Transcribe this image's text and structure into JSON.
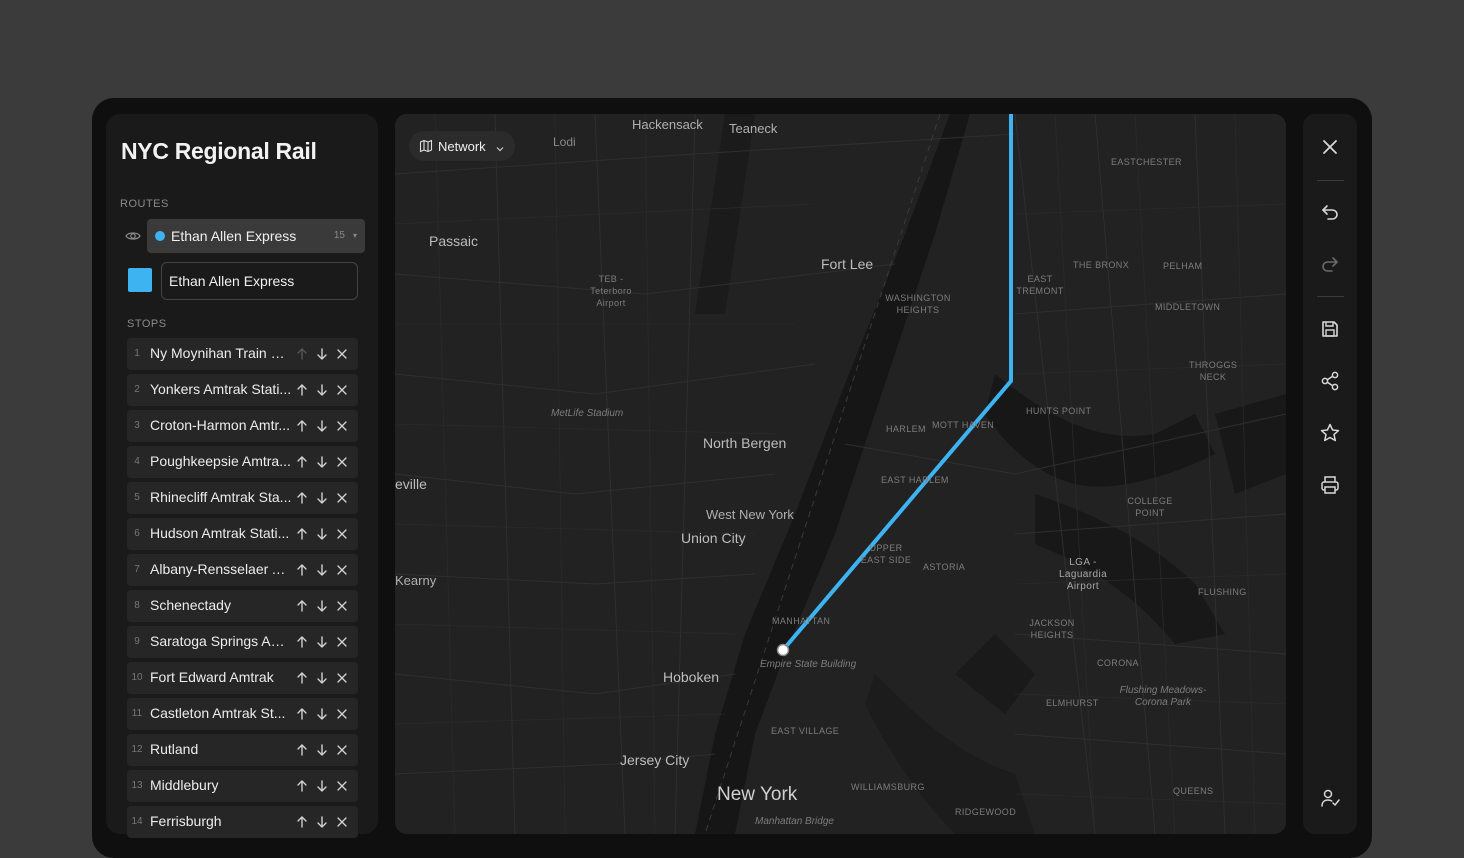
{
  "app": {
    "title": "NYC Regional Rail"
  },
  "routes": {
    "section_label": "ROUTES",
    "selected": {
      "name": "Ethan Allen Express",
      "stop_count": "15",
      "color": "#3db3f2"
    },
    "name_field_value": "Ethan Allen Express",
    "eye_icon": "eye-icon"
  },
  "stops": {
    "section_label": "STOPS",
    "items": [
      {
        "num": "1",
        "name": "Ny Moynihan Train H..."
      },
      {
        "num": "2",
        "name": "Yonkers Amtrak Stati..."
      },
      {
        "num": "3",
        "name": "Croton-Harmon Amtr..."
      },
      {
        "num": "4",
        "name": "Poughkeepsie Amtra..."
      },
      {
        "num": "5",
        "name": "Rhinecliff Amtrak Sta..."
      },
      {
        "num": "6",
        "name": "Hudson Amtrak Stati..."
      },
      {
        "num": "7",
        "name": "Albany-Rensselaer A..."
      },
      {
        "num": "8",
        "name": "Schenectady"
      },
      {
        "num": "9",
        "name": "Saratoga Springs Am..."
      },
      {
        "num": "10",
        "name": "Fort Edward Amtrak"
      },
      {
        "num": "11",
        "name": "Castleton Amtrak St..."
      },
      {
        "num": "12",
        "name": "Rutland"
      },
      {
        "num": "13",
        "name": "Middlebury"
      },
      {
        "num": "14",
        "name": "Ferrisburgh"
      }
    ]
  },
  "map": {
    "layer_button": "Network",
    "route_color": "#3db3f2",
    "labels": {
      "hackensack": "Hackensack",
      "teaneck": "Teaneck",
      "lodi": "Lodi",
      "passaic": "Passaic",
      "teb": "TEB -",
      "teterboro": "Teterboro",
      "airport1": "Airport",
      "fort_lee": "Fort Lee",
      "washington_heights_1": "WASHINGTON",
      "washington_heights_2": "HEIGHTS",
      "east_tremont_1": "EAST",
      "east_tremont_2": "TREMONT",
      "the_bronx": "THE BRONX",
      "pelham": "PELHAM",
      "eastchester": "EASTCHESTER",
      "middletown": "MIDDLETOWN",
      "throggs_neck_1": "THROGGS",
      "throggs_neck_2": "NECK",
      "hunts_point": "HUNTS POINT",
      "metlife": "MetLife Stadium",
      "north_bergen": "North Bergen",
      "harlem": "HARLEM",
      "mott_haven": "MOTT HAVEN",
      "east_harlem": "EAST HARLEM",
      "eville": "eville",
      "west_new_york": "West New York",
      "union_city": "Union City",
      "upper_east_side_1": "UPPER",
      "upper_east_side_2": "EAST SIDE",
      "astoria": "ASTORIA",
      "college_point_1": "COLLEGE",
      "college_point_2": "POINT",
      "lga_1": "LGA -",
      "lga_2": "Laguardia",
      "lga_3": "Airport",
      "flushing": "FLUSHING",
      "kearny": "Kearny",
      "manhattan": "MANHATTAN",
      "empire_state": "Empire State Building",
      "hoboken": "Hoboken",
      "jackson_heights_1": "JACKSON",
      "jackson_heights_2": "HEIGHTS",
      "corona": "CORONA",
      "flushing_meadows_1": "Flushing Meadows-",
      "flushing_meadows_2": "Corona Park",
      "elmhurst": "ELMHURST",
      "east_village": "EAST VILLAGE",
      "jersey_city": "Jersey City",
      "new_york": "New York",
      "williamsburg": "WILLIAMSBURG",
      "ridgewood": "RIDGEWOOD",
      "queens": "QUEENS",
      "manhattan_bridge": "Manhattan Bridge"
    }
  },
  "toolbar": {
    "icons": [
      "close-icon",
      "undo-icon",
      "redo-icon",
      "save-icon",
      "share-icon",
      "star-icon",
      "print-icon",
      "user-check-icon"
    ]
  }
}
